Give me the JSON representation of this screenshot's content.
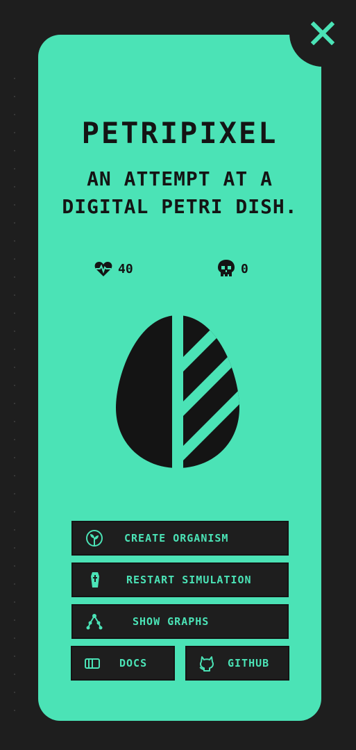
{
  "app": {
    "title": "PETRIPIXEL",
    "subtitle": "AN ATTEMPT AT A DIGITAL PETRI DISH."
  },
  "stats": {
    "alive": {
      "icon": "heart-pulse-icon",
      "value": "40"
    },
    "dead": {
      "icon": "skull-icon",
      "value": "0"
    }
  },
  "logo": {
    "icon": "leaf-egg-logo"
  },
  "close": {
    "icon": "close-icon"
  },
  "buttons": {
    "create": {
      "label": "CREATE ORGANISM",
      "icon": "sprout-icon"
    },
    "restart": {
      "label": "RESTART SIMULATION",
      "icon": "coffin-icon"
    },
    "graphs": {
      "label": "SHOW GRAPHS",
      "icon": "graph-nodes-icon"
    },
    "docs": {
      "label": "DOCS",
      "icon": "book-icon"
    },
    "github": {
      "label": "GITHUB",
      "icon": "github-icon"
    }
  },
  "colors": {
    "accent": "#4be3b6",
    "background": "#1e1e1e",
    "ink": "#141414"
  }
}
